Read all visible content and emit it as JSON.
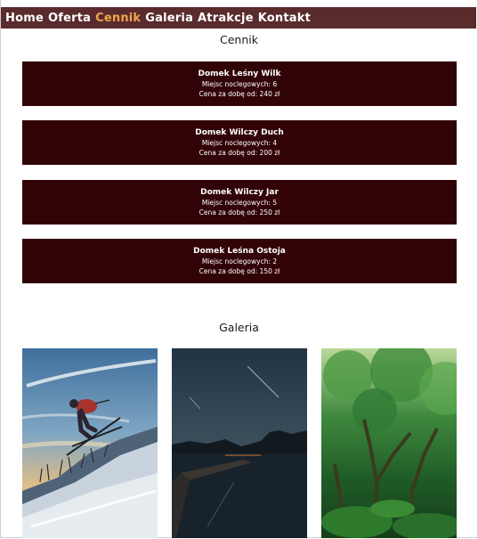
{
  "nav": {
    "items": [
      {
        "label": "Home",
        "active": false
      },
      {
        "label": "Oferta",
        "active": false
      },
      {
        "label": "Cennik",
        "active": true
      },
      {
        "label": "Galeria",
        "active": false
      },
      {
        "label": "Atrakcje",
        "active": false
      },
      {
        "label": "Kontakt",
        "active": false
      }
    ]
  },
  "pricing": {
    "title": "Cennik",
    "cards": [
      {
        "name": "Domek Leśny Wilk",
        "beds": "Miejsc noclegowych: 6",
        "price": "Cena za dobę od: 240 zł"
      },
      {
        "name": "Domek Wilczy Duch",
        "beds": "Miejsc noclegowych: 4",
        "price": "Cena za dobę od: 200 zł"
      },
      {
        "name": "Domek Wilczy Jar",
        "beds": "Miejsc noclegowych: 5",
        "price": "Cena za dobę od: 250 zł"
      },
      {
        "name": "Domek Leśna Ostoja",
        "beds": "Miejsc noclegowych: 2",
        "price": "Cena za dobę od: 150 zł"
      }
    ]
  },
  "gallery": {
    "title": "Galeria",
    "photos": [
      "skier-photo",
      "lake-sunset-photo",
      "forest-photo"
    ]
  },
  "colors": {
    "navbar": "#5a2b2d",
    "nav_active": "#f0a64a",
    "card_bg": "#320306"
  }
}
